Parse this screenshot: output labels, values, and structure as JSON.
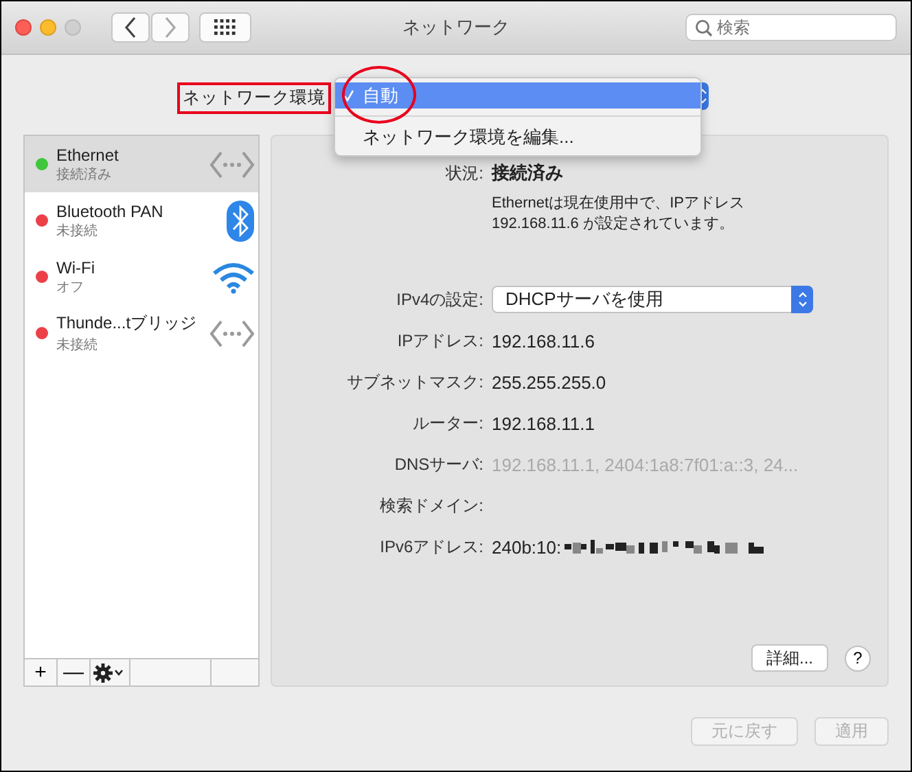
{
  "window": {
    "title": "ネットワーク",
    "search": {
      "placeholder": "検索"
    }
  },
  "location": {
    "label": "ネットワーク環境",
    "label_highlighted": true,
    "menu": [
      {
        "label": "自動",
        "selected": true,
        "circled": true
      },
      {
        "label": "ネットワーク環境を編集...",
        "selected": false,
        "circled": false
      }
    ]
  },
  "services": [
    {
      "name": "Ethernet",
      "status": "接続済み",
      "color": "#3fc63c",
      "selected": true,
      "kind": "ethernet"
    },
    {
      "name": "Bluetooth PAN",
      "status": "未接続",
      "color": "#ec4048",
      "selected": false,
      "kind": "bluetooth"
    },
    {
      "name": "Wi-Fi",
      "status": "オフ",
      "color": "#ec4048",
      "selected": false,
      "kind": "wifi"
    },
    {
      "name": "Thunde...tブリッジ",
      "status": "未接続",
      "color": "#ec4048",
      "selected": false,
      "kind": "ethernet"
    }
  ],
  "status": {
    "label": "状況:",
    "value": "接続済み",
    "description": "Ethernetは現在使用中で、IPアドレス 192.168.11.6 が設定されています。"
  },
  "fields": [
    {
      "kind": "select",
      "label": "IPv4の設定:",
      "value": "DHCPサーバを使用"
    },
    {
      "kind": "text",
      "label": "IPアドレス:",
      "value": "192.168.11.6"
    },
    {
      "kind": "text",
      "label": "サブネットマスク:",
      "value": "255.255.255.0"
    },
    {
      "kind": "text",
      "label": "ルーター:",
      "value": "192.168.11.1"
    },
    {
      "kind": "text",
      "label": "DNSサーバ:",
      "value": "192.168.11.1, 2404:1a8:7f01:a::3, 24...",
      "dimmed": true
    },
    {
      "kind": "text",
      "label": "検索ドメイン:"
    },
    {
      "kind": "redacted",
      "label": "IPv6アドレス:",
      "value": "240b:10:"
    }
  ],
  "advanced_button": "詳細...",
  "help_button": "?",
  "list_buttons": [
    "+",
    "—"
  ],
  "footer_buttons": [
    {
      "label": "元に戻す",
      "disabled": true
    },
    {
      "label": "適用",
      "disabled": true
    }
  ]
}
